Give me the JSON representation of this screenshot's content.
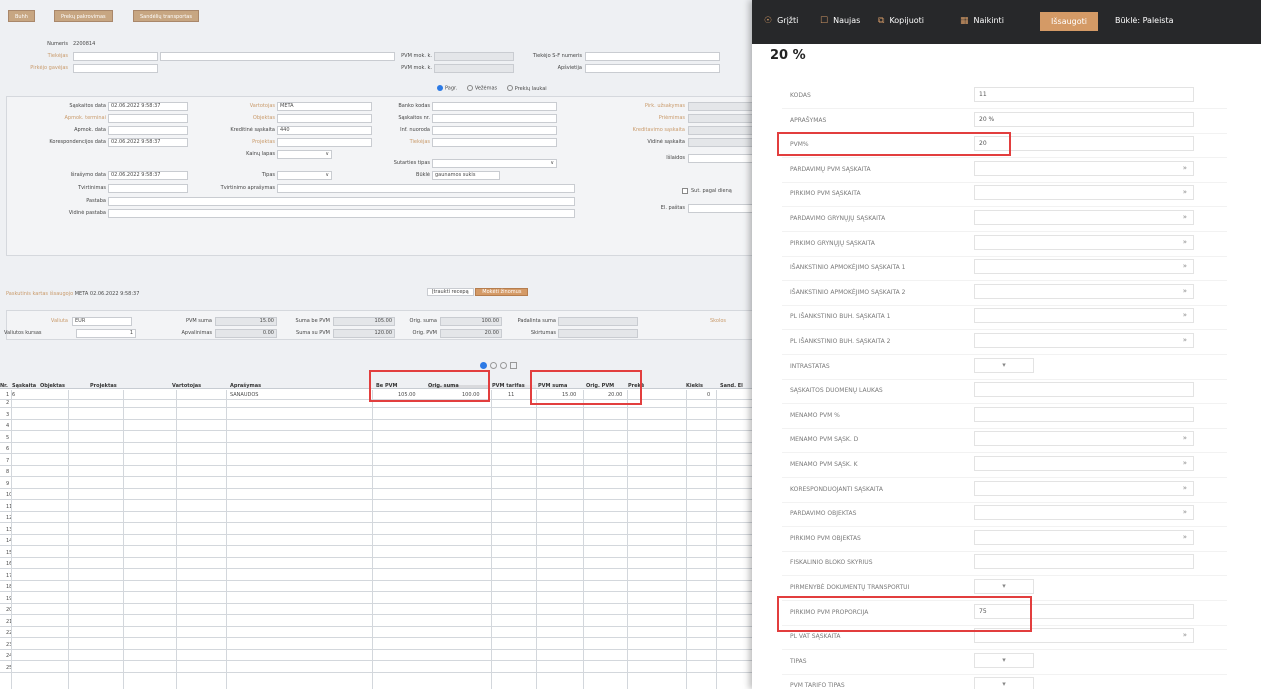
{
  "toolbar_left": {
    "btn1": "Buhh",
    "btn2": "Prekų pakrovimas",
    "btn3": "Sandėlių transportas"
  },
  "header": {
    "numeris_label": "Numeris",
    "numeris": "2200814",
    "tiekejas_label": "Tiekėjas",
    "pirkejo_label": "Pirkėjo gavėjas",
    "pvm_kodas1": "PVM mok. k.",
    "pvm_kodas2": "PVM mok. k.",
    "sf_label": "Tiekėjo S-F numeris",
    "apsivirta_label": "Apšvietija",
    "radio1": "Pagr.",
    "radio2": "Vežėmas",
    "radio3": "Prekių laukai"
  },
  "form": {
    "saskaitos_data_label": "Sąskaitos data",
    "saskaitos_data": "02.06.2022 9:58:37",
    "apmok_termins_label": "Apmok. terminai",
    "apmok_data_label": "Apmok. data",
    "koresp_data_label": "Korespondencijos data",
    "koresp_data": "02.06.2022 9:58:37",
    "israsymo_data_label": "Išrašymo data",
    "israsymo_data": "02.06.2022 9:58:37",
    "tvirtinimas_label": "Tvirtinimas",
    "pastaba_label": "Pastaba",
    "vidine_pastaba_label": "Vidinė pastaba",
    "vartotojas_label": "Vartotojas",
    "vartotojas": "META",
    "objektas_label": "Objektas",
    "kreditine_label": "Kreditinė sąskaita",
    "kreditine": "440",
    "projektas_label": "Projektas",
    "kainos_lapas_label": "Kainų lapas",
    "tipas_label": "Tipas",
    "tvirtinimo_aprasymas_label": "Tvirtinimo aprašymas",
    "banko_kodas_label": "Banko kodas",
    "saskaitos_nr_label": "Sąskaitos nr.",
    "inf_nuoroda_label": "Inf. nuoroda",
    "tiekejo_label": "Tiekėjas",
    "sutarties_tipas_label": "Sutarties tipas",
    "busena_label": "Būklė",
    "busena": "gaunamos sukis",
    "pirk_uzsakymas_label": "Pirk. užsakymas",
    "priemones_label": "Priėmimas",
    "kreditavimo_label": "Kreditavimo sąskaita",
    "vidine_saskaita_label": "Vidinė sąskaita",
    "ilkos_label": "Išlaidos",
    "sut_pagal_label": "Sut. pagal dieną",
    "el_pastas_label": "El. paštas"
  },
  "summary": {
    "paskutinis_label": "Paskutinis kartas išsaugojo",
    "paskutinis": "META 02.06.2022 9:58:37",
    "sec_btn": "Įtraukti recepą",
    "main_btn": "Mokėti žinomus",
    "valiuta_label": "Valiuta",
    "valiuta": "EUR",
    "valiutos_kursas_label": "Valiutos kursas",
    "valiutos_kursas": "1",
    "pvm_suma_label": "PVM suma",
    "pvm_suma": "15.00",
    "apvalinimas_label": "Apvalinimas",
    "apvalinimas": "0.00",
    "suma_be_pvm_label": "Suma be PVM",
    "suma_be_pvm": "105.00",
    "suma_su_pvm_label": "Suma su PVM",
    "suma_su_pvm": "120.00",
    "orig_suma_label": "Orig. suma",
    "orig_suma": "100.00",
    "orig_pvm_label": "Orig. PVM",
    "orig_pvm": "20.00",
    "padalinta_label": "Padalinta suma",
    "skirtumas_label": "Skirtumas",
    "skirtumas_label2": "Skolos"
  },
  "grid": {
    "headers": [
      "Nr.",
      "Sąskaita",
      "Objektas",
      "Projektas",
      "Vartotojas",
      "Aprašymas",
      "Be PVM",
      "Orig. suma",
      "PVM tarifas",
      "PVM suma",
      "Orig. PVM",
      "Prekė",
      "Kiekis",
      "Sand. El"
    ],
    "row1": {
      "nr": "1",
      "saskaita": "6",
      "aprasymas": "SANAUDOS",
      "be_pvm": "105.00",
      "orig_suma": "100.00",
      "pvm_tarifas": "11",
      "pvm_suma": "15.00",
      "orig_pvm": "20.00",
      "kiekis": "0"
    },
    "row_numbers": [
      "2",
      "3",
      "4",
      "5",
      "6",
      "7",
      "8",
      "9",
      "10",
      "11",
      "12",
      "13",
      "14",
      "15",
      "16",
      "17",
      "18",
      "19",
      "20",
      "21",
      "22",
      "23",
      "24",
      "25"
    ]
  },
  "panel": {
    "toolbar": {
      "close": "Grįžti",
      "new": "Naujas",
      "copy": "Kopijuoti",
      "delete": "Naikinti",
      "save": "Išsaugoti",
      "busena": "Būklė: Paleista"
    },
    "title": "20 %",
    "fields": [
      {
        "label": "KODAS",
        "value": "11",
        "arrow": ""
      },
      {
        "label": "APRAŠYMAS",
        "value": "20 %",
        "arrow": ""
      },
      {
        "label": "PVM%",
        "value": "20",
        "arrow": ""
      },
      {
        "label": "PARDAVIMŲ PVM SĄSKAITA",
        "value": "",
        "arrow": "»"
      },
      {
        "label": "PIRKIMO PVM SĄSKAITA",
        "value": "",
        "arrow": "»"
      },
      {
        "label": "PARDAVIMO GRYNŲJŲ SĄSKAITA",
        "value": "",
        "arrow": "»"
      },
      {
        "label": "PIRKIMO GRYNŲJŲ SĄSKAITA",
        "value": "",
        "arrow": "»"
      },
      {
        "label": "IŠANKSTINIO APMOKĖJIMO SĄSKAITA 1",
        "value": "",
        "arrow": "»"
      },
      {
        "label": "IŠANKSTINIO APMOKĖJIMO SĄSKAITA 2",
        "value": "",
        "arrow": "»"
      },
      {
        "label": "PL IŠANKSTINIO BUH. SĄSKAITA 1",
        "value": "",
        "arrow": "»"
      },
      {
        "label": "PL IŠANKSTINIO BUH. SĄSKAITA 2",
        "value": "",
        "arrow": "»"
      },
      {
        "label": "INTRASTATAS",
        "value": "",
        "arrow": "select"
      },
      {
        "label": "SĄSKAITOS DUOMENŲ LAUKAS",
        "value": "",
        "arrow": ""
      },
      {
        "label": "MENAMO PVM %",
        "value": "",
        "arrow": ""
      },
      {
        "label": "MENAMO PVM SĄSK. D",
        "value": "",
        "arrow": "»"
      },
      {
        "label": "MENAMO PVM SĄSK. K",
        "value": "",
        "arrow": "»"
      },
      {
        "label": "KORESPONDUOJANTI SĄSKAITA",
        "value": "",
        "arrow": "»"
      },
      {
        "label": "PARDAVIMO OBJEKTAS",
        "value": "",
        "arrow": "»"
      },
      {
        "label": "PIRKIMO PVM OBJEKTAS",
        "value": "",
        "arrow": "»"
      },
      {
        "label": "FISKALINIO BLOKO SKYRIUS",
        "value": "",
        "arrow": ""
      },
      {
        "label": "PIRMENYBĖ DOKUMENTŲ TRANSPORTUI",
        "value": "",
        "arrow": "select"
      },
      {
        "label": "PIRKIMO PVM PROPORCIJA",
        "value": "75",
        "arrow": ""
      },
      {
        "label": "PL VAT SĄSKAITA",
        "value": "",
        "arrow": "»"
      },
      {
        "label": "TIPAS",
        "value": "",
        "arrow": "select"
      },
      {
        "label": "PVM TARIFO TIPAS",
        "value": "",
        "arrow": "select"
      }
    ]
  },
  "colors": {
    "accent": "#d49a66",
    "highlight": "#e23e3e",
    "toolbar_bg": "#27282a"
  }
}
